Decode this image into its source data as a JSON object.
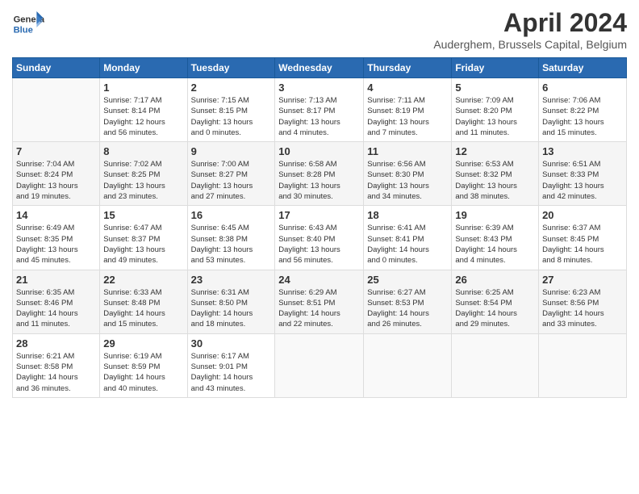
{
  "header": {
    "logo_line1": "General",
    "logo_line2": "Blue",
    "month": "April 2024",
    "location": "Auderghem, Brussels Capital, Belgium"
  },
  "weekdays": [
    "Sunday",
    "Monday",
    "Tuesday",
    "Wednesday",
    "Thursday",
    "Friday",
    "Saturday"
  ],
  "weeks": [
    [
      {
        "day": "",
        "info": ""
      },
      {
        "day": "1",
        "info": "Sunrise: 7:17 AM\nSunset: 8:14 PM\nDaylight: 12 hours\nand 56 minutes."
      },
      {
        "day": "2",
        "info": "Sunrise: 7:15 AM\nSunset: 8:15 PM\nDaylight: 13 hours\nand 0 minutes."
      },
      {
        "day": "3",
        "info": "Sunrise: 7:13 AM\nSunset: 8:17 PM\nDaylight: 13 hours\nand 4 minutes."
      },
      {
        "day": "4",
        "info": "Sunrise: 7:11 AM\nSunset: 8:19 PM\nDaylight: 13 hours\nand 7 minutes."
      },
      {
        "day": "5",
        "info": "Sunrise: 7:09 AM\nSunset: 8:20 PM\nDaylight: 13 hours\nand 11 minutes."
      },
      {
        "day": "6",
        "info": "Sunrise: 7:06 AM\nSunset: 8:22 PM\nDaylight: 13 hours\nand 15 minutes."
      }
    ],
    [
      {
        "day": "7",
        "info": "Sunrise: 7:04 AM\nSunset: 8:24 PM\nDaylight: 13 hours\nand 19 minutes."
      },
      {
        "day": "8",
        "info": "Sunrise: 7:02 AM\nSunset: 8:25 PM\nDaylight: 13 hours\nand 23 minutes."
      },
      {
        "day": "9",
        "info": "Sunrise: 7:00 AM\nSunset: 8:27 PM\nDaylight: 13 hours\nand 27 minutes."
      },
      {
        "day": "10",
        "info": "Sunrise: 6:58 AM\nSunset: 8:28 PM\nDaylight: 13 hours\nand 30 minutes."
      },
      {
        "day": "11",
        "info": "Sunrise: 6:56 AM\nSunset: 8:30 PM\nDaylight: 13 hours\nand 34 minutes."
      },
      {
        "day": "12",
        "info": "Sunrise: 6:53 AM\nSunset: 8:32 PM\nDaylight: 13 hours\nand 38 minutes."
      },
      {
        "day": "13",
        "info": "Sunrise: 6:51 AM\nSunset: 8:33 PM\nDaylight: 13 hours\nand 42 minutes."
      }
    ],
    [
      {
        "day": "14",
        "info": "Sunrise: 6:49 AM\nSunset: 8:35 PM\nDaylight: 13 hours\nand 45 minutes."
      },
      {
        "day": "15",
        "info": "Sunrise: 6:47 AM\nSunset: 8:37 PM\nDaylight: 13 hours\nand 49 minutes."
      },
      {
        "day": "16",
        "info": "Sunrise: 6:45 AM\nSunset: 8:38 PM\nDaylight: 13 hours\nand 53 minutes."
      },
      {
        "day": "17",
        "info": "Sunrise: 6:43 AM\nSunset: 8:40 PM\nDaylight: 13 hours\nand 56 minutes."
      },
      {
        "day": "18",
        "info": "Sunrise: 6:41 AM\nSunset: 8:41 PM\nDaylight: 14 hours\nand 0 minutes."
      },
      {
        "day": "19",
        "info": "Sunrise: 6:39 AM\nSunset: 8:43 PM\nDaylight: 14 hours\nand 4 minutes."
      },
      {
        "day": "20",
        "info": "Sunrise: 6:37 AM\nSunset: 8:45 PM\nDaylight: 14 hours\nand 8 minutes."
      }
    ],
    [
      {
        "day": "21",
        "info": "Sunrise: 6:35 AM\nSunset: 8:46 PM\nDaylight: 14 hours\nand 11 minutes."
      },
      {
        "day": "22",
        "info": "Sunrise: 6:33 AM\nSunset: 8:48 PM\nDaylight: 14 hours\nand 15 minutes."
      },
      {
        "day": "23",
        "info": "Sunrise: 6:31 AM\nSunset: 8:50 PM\nDaylight: 14 hours\nand 18 minutes."
      },
      {
        "day": "24",
        "info": "Sunrise: 6:29 AM\nSunset: 8:51 PM\nDaylight: 14 hours\nand 22 minutes."
      },
      {
        "day": "25",
        "info": "Sunrise: 6:27 AM\nSunset: 8:53 PM\nDaylight: 14 hours\nand 26 minutes."
      },
      {
        "day": "26",
        "info": "Sunrise: 6:25 AM\nSunset: 8:54 PM\nDaylight: 14 hours\nand 29 minutes."
      },
      {
        "day": "27",
        "info": "Sunrise: 6:23 AM\nSunset: 8:56 PM\nDaylight: 14 hours\nand 33 minutes."
      }
    ],
    [
      {
        "day": "28",
        "info": "Sunrise: 6:21 AM\nSunset: 8:58 PM\nDaylight: 14 hours\nand 36 minutes."
      },
      {
        "day": "29",
        "info": "Sunrise: 6:19 AM\nSunset: 8:59 PM\nDaylight: 14 hours\nand 40 minutes."
      },
      {
        "day": "30",
        "info": "Sunrise: 6:17 AM\nSunset: 9:01 PM\nDaylight: 14 hours\nand 43 minutes."
      },
      {
        "day": "",
        "info": ""
      },
      {
        "day": "",
        "info": ""
      },
      {
        "day": "",
        "info": ""
      },
      {
        "day": "",
        "info": ""
      }
    ]
  ]
}
